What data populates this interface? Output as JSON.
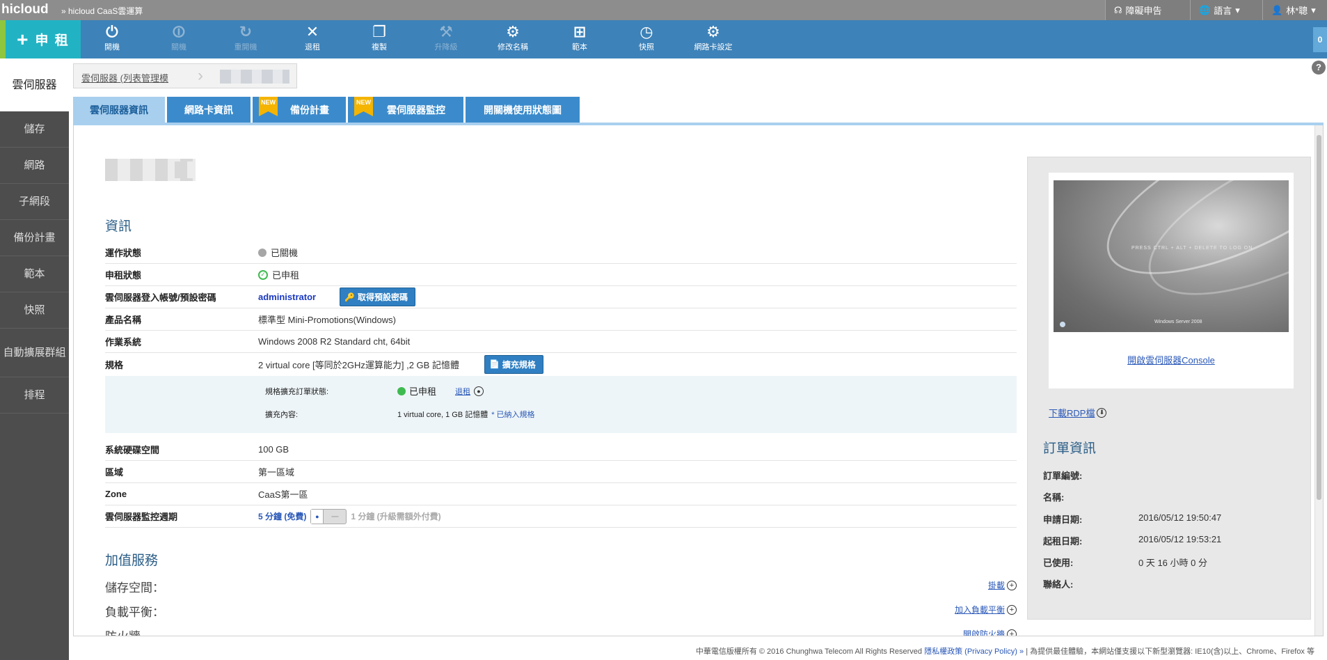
{
  "topbar": {
    "brand": "hicloud",
    "crumb": "» hicloud CaaS雲運算",
    "report": "障礙申告",
    "language": "語言",
    "user": "林*聰"
  },
  "toolbar": {
    "lease_label": "申 租",
    "tools": [
      {
        "label": "開機",
        "icon": "⏻",
        "enabled": true
      },
      {
        "label": "關機",
        "icon": "⏼",
        "enabled": false
      },
      {
        "label": "重開機",
        "icon": "↻",
        "enabled": false
      },
      {
        "label": "退租",
        "icon": "✕",
        "enabled": true
      },
      {
        "label": "複製",
        "icon": "❐",
        "enabled": true
      },
      {
        "label": "升降級",
        "icon": "⚒",
        "enabled": false
      },
      {
        "label": "修改名稱",
        "icon": "⚙",
        "enabled": true
      },
      {
        "label": "範本",
        "icon": "⊞",
        "enabled": true
      },
      {
        "label": "快照",
        "icon": "◷",
        "enabled": true
      },
      {
        "label": "網路卡設定",
        "icon": "⚙",
        "enabled": true
      }
    ],
    "count": "0"
  },
  "sidebar": {
    "items": [
      "雲伺服器",
      "儲存",
      "網路",
      "子網段",
      "備份計畫",
      "範本",
      "快照",
      "自動擴展群組",
      "排程"
    ]
  },
  "breadcrumb": {
    "root": "雲伺服器 (列表管理模"
  },
  "tabs": [
    {
      "label": "雲伺服器資訊",
      "new": false
    },
    {
      "label": "網路卡資訊",
      "new": false
    },
    {
      "label": "備份計畫",
      "new": true
    },
    {
      "label": "雲伺服器監控",
      "new": true
    },
    {
      "label": "開關機使用狀態圖",
      "new": false
    }
  ],
  "new_badge": "NEW",
  "info": {
    "section_title": "資訊",
    "rows": {
      "power_label": "運作狀態",
      "power_value": "已關機",
      "lease_label": "申租狀態",
      "lease_value": "已申租",
      "account_label": "雲伺服器登入帳號/預設密碼",
      "account_value": "administrator",
      "password_btn": "取得預設密碼",
      "product_label": "產品名稱",
      "product_value": "標準型 Mini-Promotions(Windows)",
      "os_label": "作業系統",
      "os_value": "Windows 2008 R2 Standard cht, 64bit",
      "spec_label": "規格",
      "spec_value": "2 virtual core [等同於2GHz運算能力] ,2 GB 記憶體",
      "expand_btn": "擴充規格",
      "disk_label": "系統硬碟空間",
      "disk_value": "100 GB",
      "region_label": "區域",
      "region_value": "第一區域",
      "zone_label": "Zone",
      "zone_value": "CaaS第一區",
      "monitor_label": "雲伺服器監控週期",
      "monitor_free": "5 分鐘 (免費)",
      "monitor_toggle_off": "一",
      "monitor_paid": "1 分鐘 (升級需額外付費)"
    },
    "spec_box": {
      "order_label": "規格擴充訂單狀態:",
      "order_status": "已申租",
      "cancel_link": "退租",
      "content_label": "擴充內容:",
      "content_value": "1 virtual core, 1 GB 記憶體",
      "included": "* 已納入規格"
    }
  },
  "addon": {
    "section_title": "加值服務",
    "storage_label": "儲存空間：",
    "storage_action": "掛載",
    "lb_label": "負載平衡：",
    "lb_action": "加入負載平衡",
    "fw_label": "防火牆",
    "fw_action": "開啟防火牆"
  },
  "right_panel": {
    "console_screen_text": "PRESS CTRL + ALT + DELETE TO LOG ON",
    "console_brand": "Windows Server 2008",
    "console_link": "開啟雲伺服器Console",
    "rdp_link": "下載RDP檔",
    "order_title": "訂單資訊",
    "order_rows": [
      {
        "k": "訂單編號:",
        "v": ""
      },
      {
        "k": "名稱:",
        "v": ""
      },
      {
        "k": "申請日期:",
        "v": "2016/05/12 19:50:47"
      },
      {
        "k": "起租日期:",
        "v": "2016/05/12 19:53:21"
      },
      {
        "k": "已使用:",
        "v": "0 天 16 小時 0 分"
      },
      {
        "k": "聯絡人:",
        "v": ""
      }
    ]
  },
  "footer": {
    "copyright": "中華電信版權所有 © 2016 Chunghwa Telecom All Rights Reserved",
    "privacy": "隱私權政策 (Privacy Policy) »",
    "browser": "為提供最佳體驗，本網站僅支援以下新型瀏覽器: IE10(含)以上、Chrome、Firefox 等"
  }
}
